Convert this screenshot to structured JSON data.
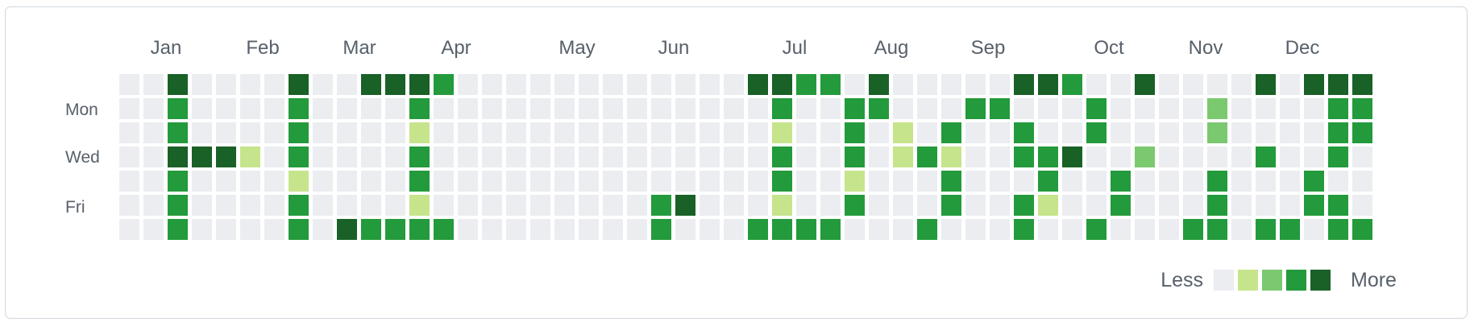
{
  "chart_data": {
    "type": "heatmap",
    "title": "",
    "months": [
      "Jan",
      "Feb",
      "Mar",
      "Apr",
      "May",
      "Jun",
      "Jul",
      "Aug",
      "Sep",
      "Oct",
      "Nov",
      "Dec"
    ],
    "month_start_weeks": [
      1,
      5,
      9,
      13,
      18,
      22,
      27,
      31,
      35,
      40,
      44,
      48
    ],
    "weekday_labels": [
      {
        "row": 1,
        "label": "Mon"
      },
      {
        "row": 3,
        "label": "Wed"
      },
      {
        "row": 5,
        "label": "Fri"
      }
    ],
    "levels_note": "0 = no contributions (lightest) ... 4 = most contributions (darkest)",
    "weeks": 53,
    "grid": [
      "0040000400444300000000000044330400000443004000040444",
      "0030000300003000000000000003003300033000300002000033",
      "0030000300001000000000000001003010300300300002000033",
      "0044410300003000000000000003003013100334002000030030",
      "0030000100003000000000000003001000300030030003000300",
      "0030000300001000000000340001003000300310030003000330",
      "0030000304333300000000300033330003000300300033033033"
    ],
    "legend": {
      "less_label": "Less",
      "more_label": "More",
      "level_colors": [
        "#ebedf0",
        "#c6e48b",
        "#7bc96f",
        "#239a3b",
        "#196127"
      ]
    }
  },
  "colors": {
    "level0": "#ebedf0",
    "level1": "#c6e48b",
    "level2": "#7bc96f",
    "level3": "#239a3b",
    "level4": "#196127",
    "label_text": "#57606a",
    "border": "#d0d7de"
  }
}
